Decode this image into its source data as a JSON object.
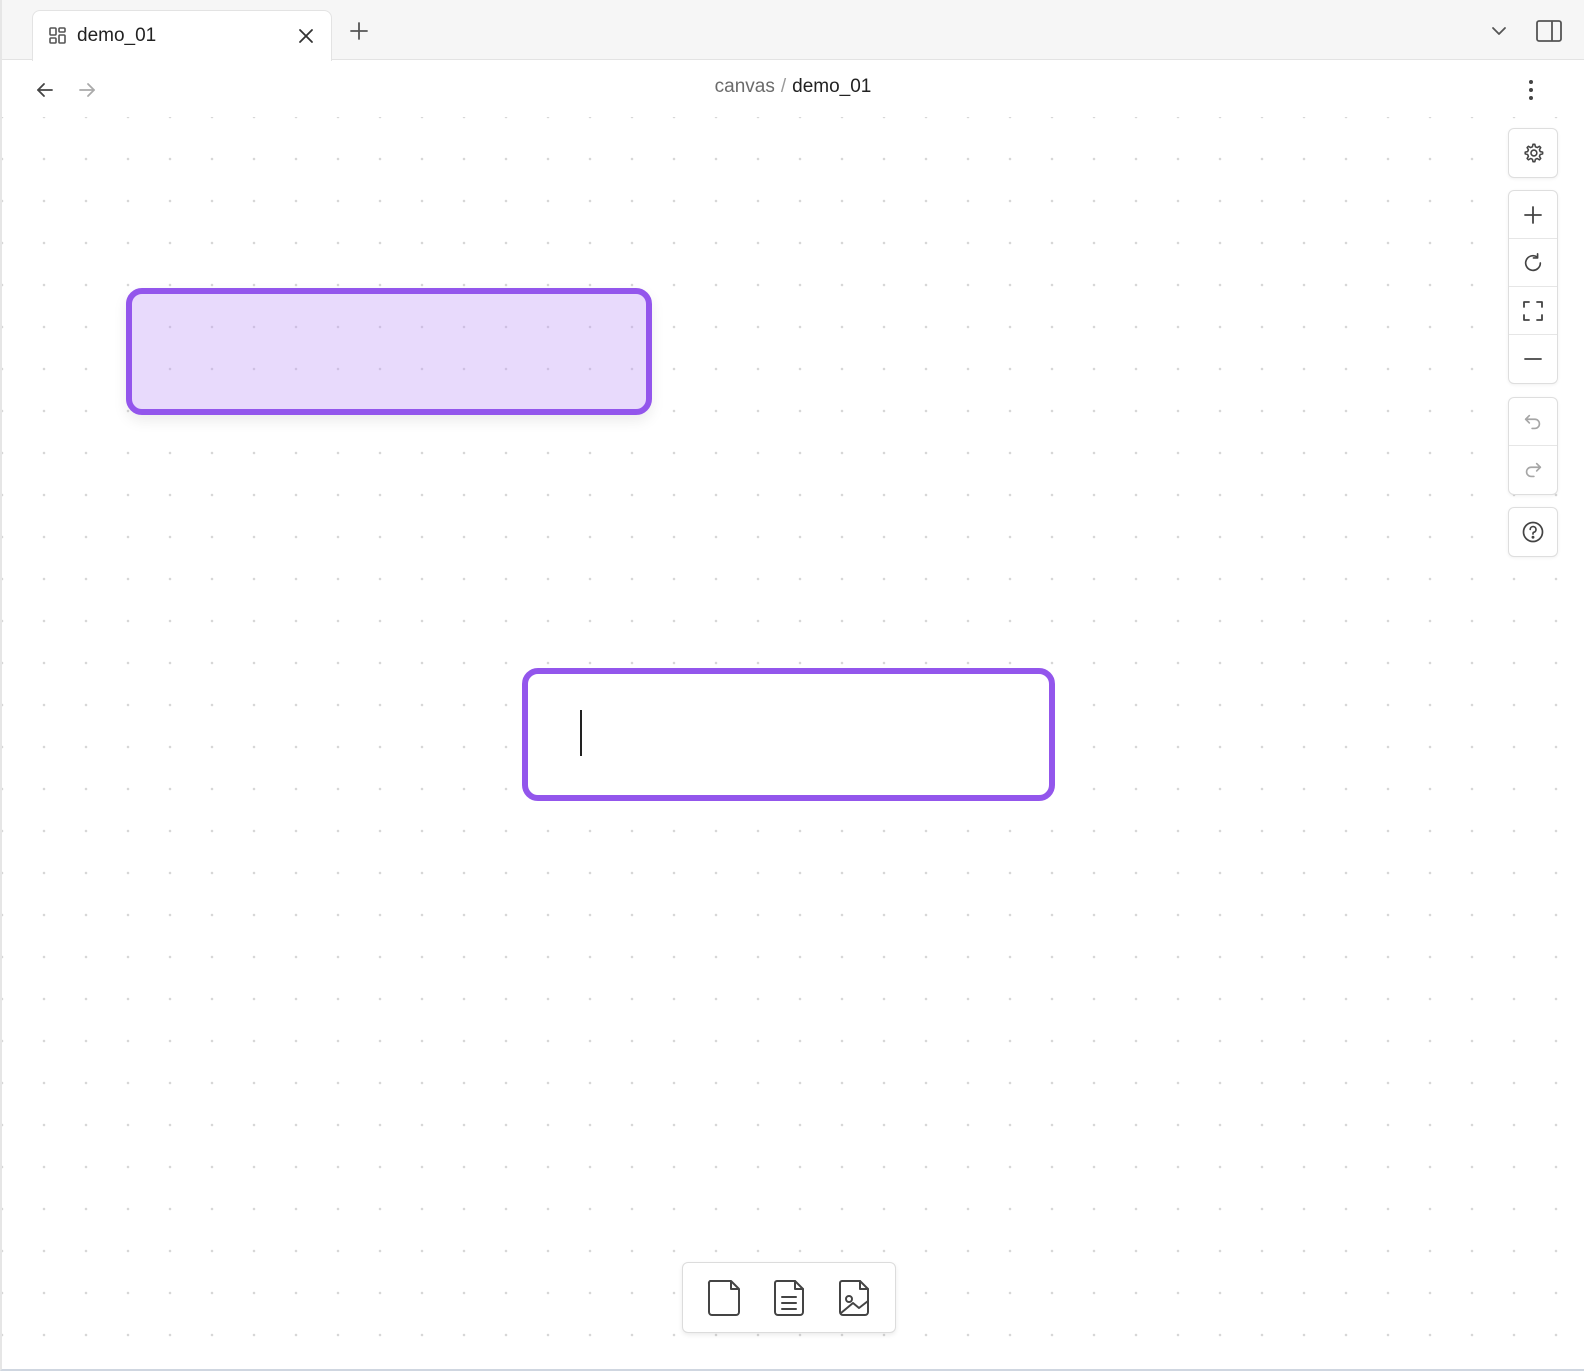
{
  "tabbar": {
    "tab": {
      "title": "demo_01",
      "icon": "canvas-icon"
    },
    "close_icon": "close-icon",
    "new_tab_icon": "plus-icon",
    "dropdown_icon": "chevron-down-icon",
    "sidebar_icon": "sidebar-toggle-icon"
  },
  "navbar": {
    "back_icon": "arrow-left-icon",
    "forward_icon": "arrow-right-icon",
    "breadcrumb": {
      "parent": "canvas",
      "separator": "/",
      "current": "demo_01"
    },
    "more_icon": "more-vertical-icon"
  },
  "canvas": {
    "accent_color": "#9356ec",
    "nodes": [
      {
        "id": "node-1",
        "text": "",
        "state": "selected"
      },
      {
        "id": "node-2",
        "text": "",
        "state": "editing"
      }
    ]
  },
  "controls": {
    "settings_icon": "gear-icon",
    "zoom_group": [
      "zoom-in-icon",
      "reset-icon",
      "fit-screen-icon",
      "zoom-out-icon"
    ],
    "history_group": [
      "undo-icon",
      "redo-icon"
    ],
    "help_icon": "help-icon"
  },
  "bottom_toolbar": [
    "new-card-icon",
    "new-note-icon",
    "new-media-icon"
  ]
}
